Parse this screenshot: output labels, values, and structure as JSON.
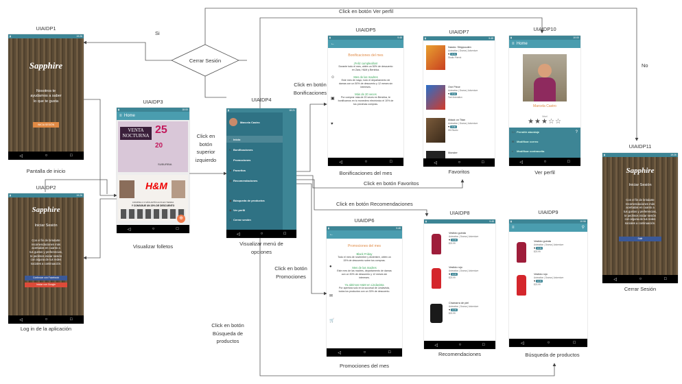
{
  "screens": {
    "p1": {
      "id": "UIAIDP1",
      "caption": "Pantalla de inicio",
      "logo": "Sapphire",
      "text": [
        "Nosotros te",
        "ayudamos a saber",
        "lo que te gusta"
      ],
      "button": "INICIA SESIÓN",
      "time": "19:26"
    },
    "p2": {
      "id": "UIAIDP2",
      "caption": "Log in de la aplicación",
      "logo": "Sapphire",
      "title": "Iniciar Sesión",
      "text": [
        "Con el fin de brindarte",
        "recomendaciones más",
        "acertadas en cuanto a",
        "tus gustos y preferencias,",
        "te pedimos iniciar sesión",
        "con alguna de tus redes",
        "sociales a continuación."
      ],
      "fb": "Continuar con Facebook",
      "google": "Iniciar con Google",
      "time": "19:26"
    },
    "p3": {
      "id": "UIAIDP3",
      "caption": "Visualizar folletos",
      "bar": "Home",
      "banner1a": "VENTA",
      "banner1b": "NOCTURNA",
      "banner1c": "25",
      "banner1d": "20",
      "banner1e": "SUBURBIA",
      "banner2a": "H&M",
      "banner2b": "COMPRA 2 O MÁS ARTÍCULOS EN TIENDA",
      "banner2c": "Y CONSIGUE UN 20% DE DESCUENTO",
      "time": "18:00"
    },
    "p4": {
      "id": "UIAIDP4",
      "caption1": "Visualizar menú de",
      "caption2": "opciones",
      "user": "Marcela Castro",
      "items": [
        "Inicio",
        "Bonificaciones",
        "Promociones",
        "Favoritos",
        "Recomendaciones",
        "Búsqueda de productos",
        "Ver perfil",
        "Cerrar sesión"
      ],
      "time": "18:21"
    },
    "p5": {
      "id": "UIAIDP5",
      "caption": "Bonificaciones del mes",
      "heading": "Bonificaciones del mes",
      "s1h": "¡Feliz cumpleaños!",
      "s1t": "Durante todo el mes, obtén un 50% de descuento en Zara, H&M y Bershka.",
      "s2h": "Mes de las madres",
      "s2t": "Este mes de mayo, todo el departamento de damas con un 50% de descuento y 12 meses sin intereses.",
      "s3h": "Más de 20 veces",
      "s3t": "Por comprar más de 20 veces en Bershka, te bonificamos en tu monedero electrónico el 10% de tus próximas compras.",
      "time": "9:48"
    },
    "p6": {
      "id": "UIAIDP6",
      "caption": "Promociones del mes",
      "heading": "Promociones del mes",
      "s1h": "Black Friday",
      "s1t": "Todo el mes de noviembre y diciembre, obtén un 15% de descuento sobre tus compras.",
      "s2h": "Mes de las madres",
      "s2t": "Este mes de las madres, departamento de damas con un 30% de descuento y 12 meses sin intereses.",
      "s3h": "Ya abrimos H&M en Lindavista",
      "s3t": "Por apertura solo en la sucursal de Lindavista, todos los productos con un 30% de descuento.",
      "time": "9:48"
    },
    "p7": {
      "id": "UIAIDP7",
      "caption": "Favoritos",
      "items": [
        {
          "title": "Naruto: Shippuuden",
          "genre": "Animation | Drama | Adventure",
          "rating": "8.70",
          "studio": "Studio Pierrot"
        },
        {
          "title": "One Piece",
          "genre": "Animation | Drama | Adventure",
          "rating": "8.64",
          "studio": "Toei Animation"
        },
        {
          "title": "Attack on Titan",
          "genre": "Animation | Drama | Adventure",
          "rating": "8.80",
          "studio": "Wit Studio"
        },
        {
          "title": "Monster",
          "genre": "",
          "rating": "",
          "studio": ""
        }
      ],
      "time": "9:48"
    },
    "p8": {
      "id": "UIAIDP8",
      "caption": "Recomendaciones",
      "items": [
        {
          "title": "Vestido guinda",
          "genre": "Animation | Drama | Adventure",
          "rating": "8.78",
          "price": "$23.99"
        },
        {
          "title": "Vestido rojo",
          "genre": "Animation | Drama | Adventure",
          "rating": "8.78",
          "price": "$23.99"
        },
        {
          "title": "Chamarra de piel",
          "genre": "Animation | Drama | Adventure",
          "rating": "8.78",
          "price": "$23.99"
        }
      ],
      "time": "9:48"
    },
    "p9": {
      "id": "UIAIDP9",
      "caption": "Búsqueda de productos",
      "items": [
        {
          "title": "Vestido guinda",
          "genre": "Animation | Drama | Adventure",
          "rating": "8.78",
          "price": "$23.99"
        },
        {
          "title": "Vestido rojo",
          "genre": "Animation | Drama | Adventure",
          "rating": "8.78",
          "price": "$23.99"
        }
      ],
      "time": "10:56"
    },
    "p10": {
      "id": "UIAIDP10",
      "caption": "Ver perfil",
      "bar": "Home",
      "name": "Marcela Castro",
      "level": "Nivel",
      "stars_filled": 3,
      "stars_total": 5,
      "opts": [
        "Permitir abordaje",
        "Modificar correo",
        "Modificar contraseña"
      ],
      "time": "10:00"
    },
    "p11": {
      "id": "UIAIDP11",
      "caption": "Cerrar Sesión",
      "logo": "Sapphire",
      "title": "Iniciar Sesión",
      "text": [
        "Con el fin de brindarte",
        "recomendaciones más",
        "acertadas en cuanto a",
        "tus gustos y preferencias,",
        "te pedimos iniciar sesión",
        "con alguna de tus redes",
        "sociales a continuación."
      ],
      "fb": "Salir",
      "time": "19:26"
    }
  },
  "decision": {
    "label": "Cerrar Sesión",
    "yes": "Si",
    "no": "No"
  },
  "edges": {
    "perfil": "Click en botón Ver perfil",
    "bonif1": "Click en botón",
    "bonif2": "Bonificaciones",
    "sup1": "Click en",
    "sup2": "botón",
    "sup3": "superior",
    "sup4": "izquierdo",
    "fav": "Click en botón Favoritos",
    "recom": "Click en botón Recomendaciones",
    "promo1": "Click en botón",
    "promo2": "Promociones",
    "busq1": "Click en botón",
    "busq2": "Búsqueda de",
    "busq3": "productos"
  },
  "colors": {
    "bar": "#4a9daf",
    "status": "#3d8595",
    "accent": "#e08a45",
    "green": "#3aa65a",
    "facebook": "#3b5998",
    "google": "#dd4b39"
  }
}
